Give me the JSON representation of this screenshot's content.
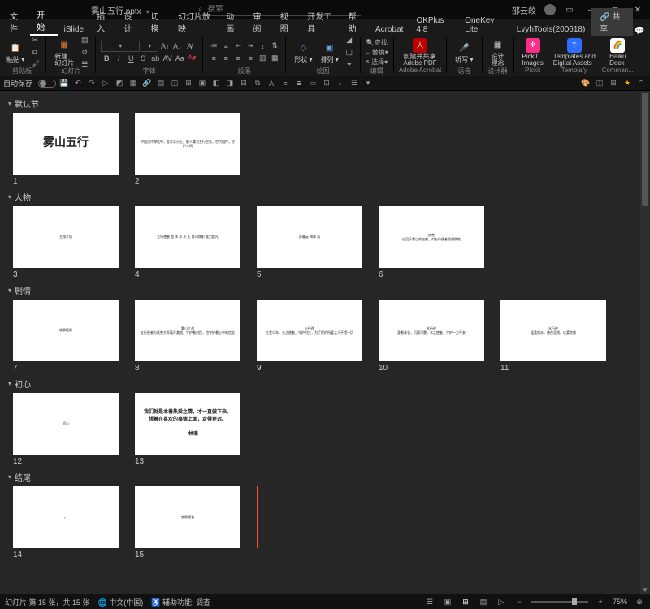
{
  "titlebar": {
    "filename": "雾山五行.pptx",
    "search_placeholder": "搜索",
    "user": "邵云皎"
  },
  "menu": {
    "items": [
      "文件",
      "开始",
      "iSlide",
      "插入",
      "设计",
      "切换",
      "幻灯片放映",
      "动画",
      "审阅",
      "视图",
      "开发工具",
      "帮助",
      "Acrobat",
      "OKPlus 4.8",
      "OneKey Lite",
      "LvyhTools(200618)"
    ],
    "active_index": 1,
    "share": "共享"
  },
  "ribbon": {
    "clipboard": {
      "paste": "粘贴",
      "caption": "剪贴板"
    },
    "slides": {
      "new": "新建\n幻灯片",
      "caption": "幻灯片"
    },
    "font": {
      "caption": "字体"
    },
    "paragraph": {
      "caption": "段落"
    },
    "drawing": {
      "shapes": "形状",
      "arrange": "排列",
      "caption": "绘图"
    },
    "editing": {
      "find": "查找",
      "replace": "替换",
      "select": "选择",
      "caption": "编辑"
    },
    "adobe": {
      "create": "创建并共享\nAdobe PDF",
      "caption": "Adobe Acrobat"
    },
    "voice": {
      "dict": "听写",
      "caption": "语音"
    },
    "designer": {
      "ideas": "设计\n理念",
      "caption": "设计器"
    },
    "addins": {
      "pickit": "Pickit\nImages",
      "templafy": "Templates and\nDigital Assets",
      "haiku": "Haiku\nDeck",
      "cap_pickit": "Pickit",
      "cap_templafy": "Templafy",
      "cap_comman": "Comman..."
    }
  },
  "qat": {
    "autosave": "自动保存"
  },
  "sections": [
    {
      "name": "默认节",
      "slides": [
        {
          "n": "1",
          "big": "雾山五行"
        },
        {
          "n": "2",
          "t": "中国古代神话中，金木水火土，被人尊为五行世家，世代相传，守护人间"
        }
      ]
    },
    {
      "name": "人物",
      "slides": [
        {
          "n": "3",
          "t": "主角介绍"
        },
        {
          "n": "4",
          "t": "五行使者  金  木  水  火  土  各司其职  能力超凡"
        },
        {
          "n": "5",
          "t": "苏暮云         梅林         焱"
        },
        {
          "n": "6",
          "t": "妖兽\n出没于雾山的凶兽，对五行使者虎视眈眈"
        }
      ]
    },
    {
      "name": "剧情",
      "slides": [
        {
          "n": "7",
          "t": "故事梗概"
        },
        {
          "n": "8",
          "t": "雾山之战\n五行使者与妖兽大军展开激战，守护着村民，也守护着心中的信念"
        },
        {
          "n": "9",
          "t": "火行使\n红发少年，火之使者，守护村庄，为了保护所爱之人不惜一切"
        },
        {
          "n": "10",
          "t": "木行使\n身着青衣，沉稳可靠，木之使者，守护一方平安"
        },
        {
          "n": "11",
          "t": "水行使\n温柔如水，善良坚韧，以柔克刚"
        }
      ]
    },
    {
      "name": "初心",
      "slides": [
        {
          "n": "12",
          "t": "初心"
        },
        {
          "n": "13",
          "med": "我们就是本着热爱之情，才一直做下来。\n想着在喜欢的事情上面，走得更远。\n\n—— 林魂"
        }
      ]
    },
    {
      "name": "结尾",
      "slides": [
        {
          "n": "14",
          "t": "。"
        },
        {
          "n": "15",
          "t": "感谢观看"
        }
      ],
      "insertionAfter": true
    }
  ],
  "status": {
    "slideinfo": "幻灯片 第 15 张，共 15 张",
    "lang": "中文(中国)",
    "access": "辅助功能: 调查",
    "zoom": "75%"
  }
}
